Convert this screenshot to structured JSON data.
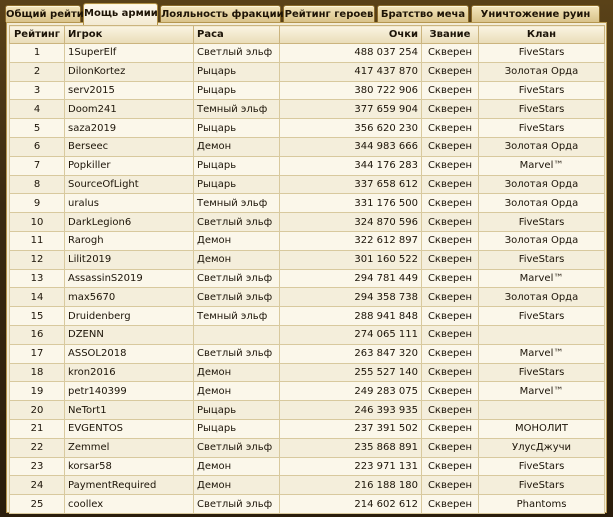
{
  "tabs": [
    {
      "label": "Общий рейтинг",
      "active": false
    },
    {
      "label": "Мощь армии",
      "active": true
    },
    {
      "label": "Лояльность фракции",
      "active": false
    },
    {
      "label": "Рейтинг героев",
      "active": false
    },
    {
      "label": "Братство меча",
      "active": false
    },
    {
      "label": "Уничтожение руин",
      "active": false
    }
  ],
  "table": {
    "headers": {
      "rank": "Рейтинг",
      "player": "Игрок",
      "race": "Раса",
      "score": "Очки",
      "title": "Звание",
      "clan": "Клан"
    },
    "rows": [
      {
        "rank": "1",
        "player": "1SuperElf",
        "race": "Светлый эльф",
        "score": "488 037 254",
        "title": "Скверен",
        "clan": "FiveStars"
      },
      {
        "rank": "2",
        "player": "DilonKortez",
        "race": "Рыцарь",
        "score": "417 437 870",
        "title": "Скверен",
        "clan": "Золотая Орда"
      },
      {
        "rank": "3",
        "player": "serv2015",
        "race": "Рыцарь",
        "score": "380 722 906",
        "title": "Скверен",
        "clan": "FiveStars"
      },
      {
        "rank": "4",
        "player": "Doom241",
        "race": "Темный эльф",
        "score": "377 659 904",
        "title": "Скверен",
        "clan": "FiveStars"
      },
      {
        "rank": "5",
        "player": "saza2019",
        "race": "Рыцарь",
        "score": "356 620 230",
        "title": "Скверен",
        "clan": "FiveStars"
      },
      {
        "rank": "6",
        "player": "Berseec",
        "race": "Демон",
        "score": "344 983 666",
        "title": "Скверен",
        "clan": "Золотая Орда"
      },
      {
        "rank": "7",
        "player": "Popkiller",
        "race": "Рыцарь",
        "score": "344 176 283",
        "title": "Скверен",
        "clan": "Marvel™"
      },
      {
        "rank": "8",
        "player": "SourceOfLight",
        "race": "Рыцарь",
        "score": "337 658 612",
        "title": "Скверен",
        "clan": "Золотая Орда"
      },
      {
        "rank": "9",
        "player": "uralus",
        "race": "Темный эльф",
        "score": "331 176 500",
        "title": "Скверен",
        "clan": "Золотая Орда"
      },
      {
        "rank": "10",
        "player": "DarkLegion6",
        "race": "Светлый эльф",
        "score": "324 870 596",
        "title": "Скверен",
        "clan": "FiveStars"
      },
      {
        "rank": "11",
        "player": "Rarogh",
        "race": "Демон",
        "score": "322 612 897",
        "title": "Скверен",
        "clan": "Золотая Орда"
      },
      {
        "rank": "12",
        "player": "Lilit2019",
        "race": "Демон",
        "score": "301 160 522",
        "title": "Скверен",
        "clan": "FiveStars"
      },
      {
        "rank": "13",
        "player": "AssassinS2019",
        "race": "Светлый эльф",
        "score": "294 781 449",
        "title": "Скверен",
        "clan": "Marvel™"
      },
      {
        "rank": "14",
        "player": "max5670",
        "race": "Светлый эльф",
        "score": "294 358 738",
        "title": "Скверен",
        "clan": "Золотая Орда"
      },
      {
        "rank": "15",
        "player": "Druidenberg",
        "race": "Темный эльф",
        "score": "288 941 848",
        "title": "Скверен",
        "clan": "FiveStars"
      },
      {
        "rank": "16",
        "player": "DZENN",
        "race": "",
        "score": "274 065 111",
        "title": "Скверен",
        "clan": ""
      },
      {
        "rank": "17",
        "player": "ASSOL2018",
        "race": "Светлый эльф",
        "score": "263 847 320",
        "title": "Скверен",
        "clan": "Marvel™"
      },
      {
        "rank": "18",
        "player": "kron2016",
        "race": "Демон",
        "score": "255 527 140",
        "title": "Скверен",
        "clan": "FiveStars"
      },
      {
        "rank": "19",
        "player": "petr140399",
        "race": "Демон",
        "score": "249 283 075",
        "title": "Скверен",
        "clan": "Marvel™"
      },
      {
        "rank": "20",
        "player": "NeTort1",
        "race": "Рыцарь",
        "score": "246 393 935",
        "title": "Скверен",
        "clan": ""
      },
      {
        "rank": "21",
        "player": "EVGENTOS",
        "race": "Рыцарь",
        "score": "237 391 502",
        "title": "Скверен",
        "clan": "МОНОЛИТ"
      },
      {
        "rank": "22",
        "player": "Zemmel",
        "race": "Светлый эльф",
        "score": "235 868 891",
        "title": "Скверен",
        "clan": "УлусДжучи"
      },
      {
        "rank": "23",
        "player": "korsar58",
        "race": "Демон",
        "score": "223 971 131",
        "title": "Скверен",
        "clan": "FiveStars"
      },
      {
        "rank": "24",
        "player": "PaymentRequired",
        "race": "Демон",
        "score": "216 188 180",
        "title": "Скверен",
        "clan": "FiveStars"
      },
      {
        "rank": "25",
        "player": "coollex",
        "race": "Светлый эльф",
        "score": "214 602 612",
        "title": "Скверен",
        "clan": "Phantoms"
      }
    ]
  }
}
